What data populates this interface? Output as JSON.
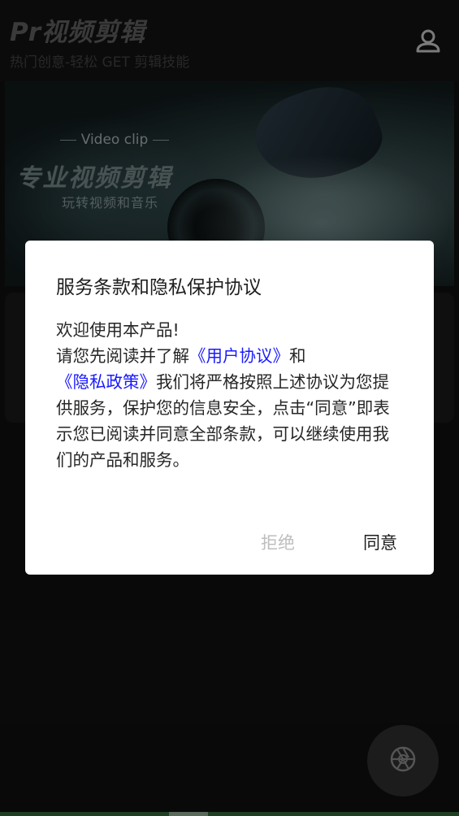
{
  "header": {
    "title": "Pr视频剪辑",
    "subtitle": "热门创意-轻松 GET 剪辑技能",
    "profile_icon": "user-profile-icon"
  },
  "banner": {
    "caption": "Video clip",
    "headline": "专业视频剪辑",
    "tagline": "玩转视频和音乐"
  },
  "dialog": {
    "title": "服务条款和隐私保护协议",
    "greeting": "欢迎使用本产品!",
    "intro": "请您先阅读并了解",
    "user_agreement_link": "《用户协议》",
    "and": "和",
    "privacy_link": "《隐私政策》",
    "body": "我们将严格按照上述协议为您提供服务，保护您的信息安全，点击“同意”即表示您已阅读并同意全部条款，可以继续使用我们的产品和服务。",
    "decline_label": "拒绝",
    "agree_label": "同意"
  },
  "fab": {
    "icon": "camera-aperture-icon"
  },
  "colors": {
    "link": "#1a1aff",
    "decline": "#bdbdbd",
    "background": "#0f0f0f"
  }
}
